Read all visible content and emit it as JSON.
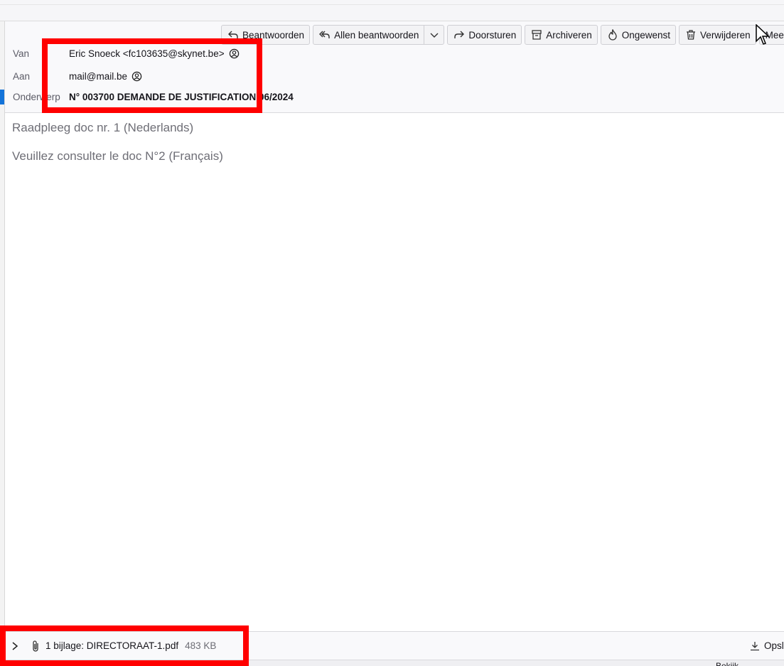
{
  "toolbar": {
    "reply": "Beantwoorden",
    "reply_all": "Allen beantwoorden",
    "forward": "Doorsturen",
    "archive": "Archiveren",
    "junk": "Ongewenst",
    "delete": "Verwijderen",
    "more": "Meer"
  },
  "header": {
    "from_label": "Van",
    "from_value": "Eric Snoeck <fc103635@skynet.be>",
    "to_label": "Aan",
    "to_value": "mail@mail.be",
    "subject_label": "Onderwerp",
    "subject_value": "N° 003700 DEMANDE DE JUSTIFICATION 06/2024"
  },
  "body": {
    "line1": "Raadpleeg doc nr. 1 (Nederlands)",
    "line2": "Veuillez consulter le doc N°2 (Français)"
  },
  "attachments": {
    "label": "1 bijlage: DIRECTORAAT-1.pdf",
    "size": "483 KB",
    "save": "Opslaan"
  },
  "statusbar": {
    "button": "Bekijk"
  },
  "colors": {
    "highlight": "#ff0000",
    "selection": "#1373d9"
  }
}
